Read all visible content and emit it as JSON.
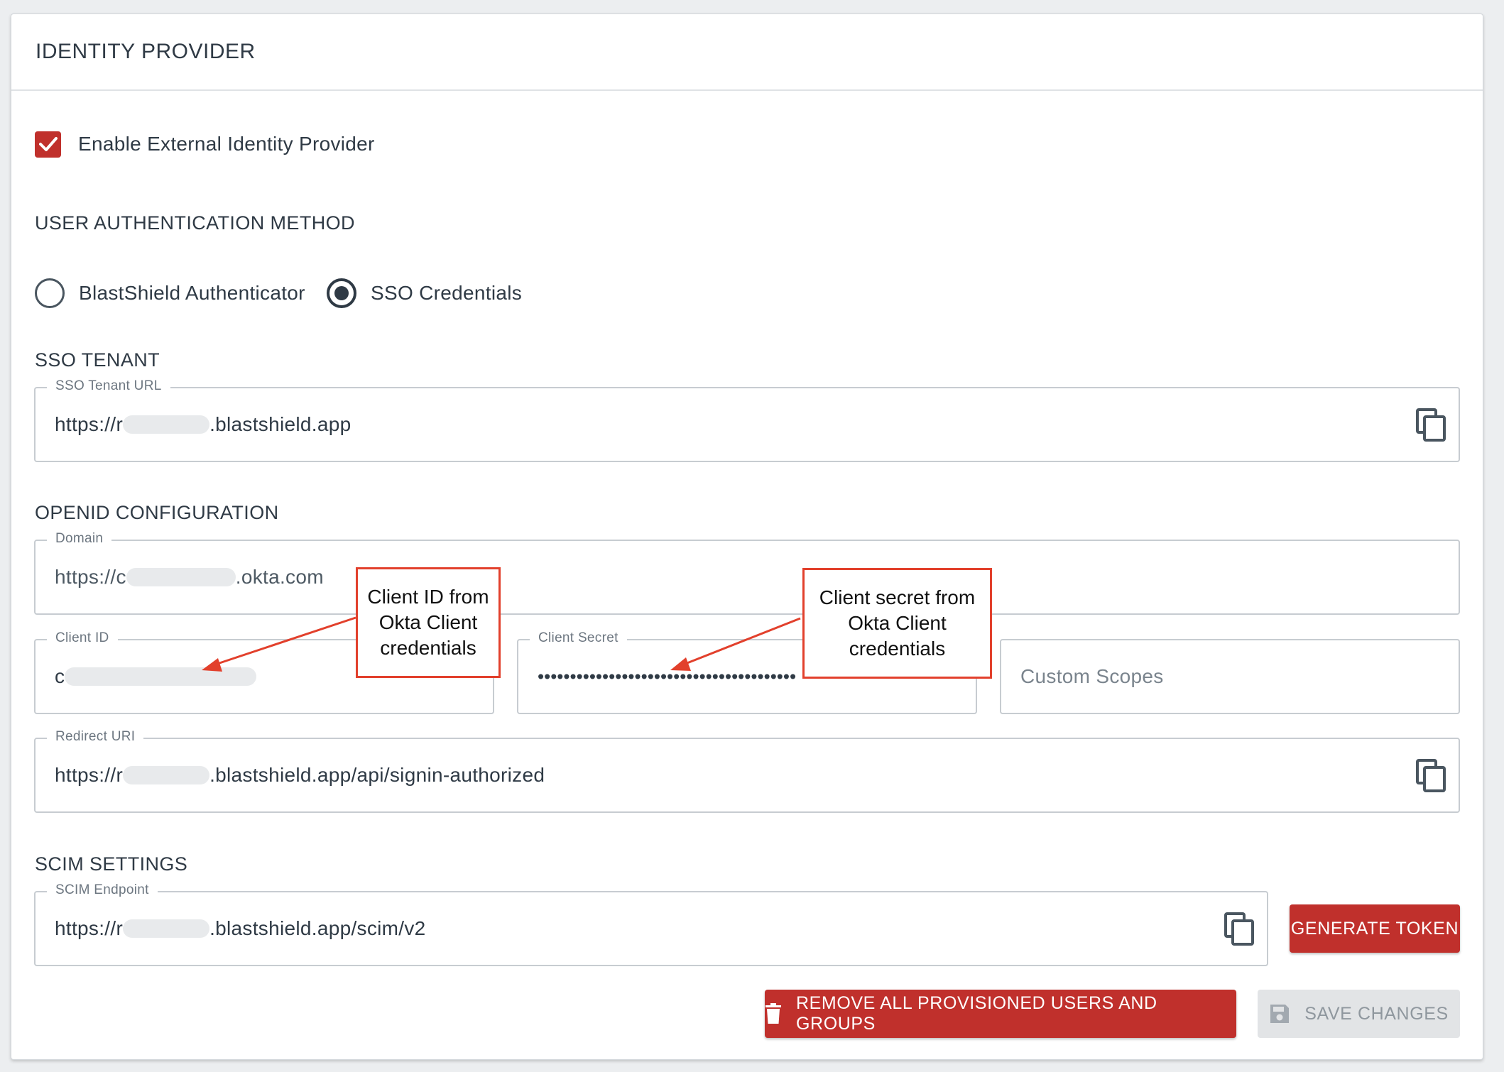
{
  "card": {
    "title": "IDENTITY PROVIDER"
  },
  "enable_idp": {
    "label": "Enable External Identity Provider",
    "checked": true
  },
  "auth_method": {
    "title": "USER AUTHENTICATION METHOD",
    "options": [
      {
        "label": "BlastShield Authenticator",
        "selected": false
      },
      {
        "label": "SSO Credentials",
        "selected": true
      }
    ]
  },
  "sso_tenant": {
    "title": "SSO TENANT",
    "url_label": "SSO Tenant URL",
    "url_prefix": "https://r",
    "url_suffix": ".blastshield.app"
  },
  "openid": {
    "title": "OPENID CONFIGURATION",
    "domain_label": "Domain",
    "domain_prefix": "https://c",
    "domain_suffix": ".okta.com",
    "client_id_label": "Client ID",
    "client_id_prefix": "c",
    "client_secret_label": "Client Secret",
    "client_secret_value": "••••••••••••••••••••••••••••••••••••••••",
    "custom_scopes_placeholder": "Custom Scopes",
    "redirect_label": "Redirect URI",
    "redirect_prefix": "https://r",
    "redirect_suffix": ".blastshield.app/api/signin-authorized"
  },
  "scim": {
    "title": "SCIM SETTINGS",
    "endpoint_label": "SCIM Endpoint",
    "endpoint_prefix": "https://r",
    "endpoint_suffix": ".blastshield.app/scim/v2",
    "generate_token_label": "GENERATE TOKEN"
  },
  "actions": {
    "remove_label": "REMOVE ALL PROVISIONED USERS AND GROUPS",
    "save_label": "SAVE CHANGES"
  },
  "callouts": {
    "client_id": [
      "Client ID from",
      "Okta Client",
      "credentials"
    ],
    "client_secret": [
      "Client secret from",
      "Okta Client",
      "credentials"
    ]
  },
  "colors": {
    "accent": "#c0302c",
    "callout": "#e2402c",
    "text": "#2f3a45",
    "border": "#c7ccd1"
  },
  "icons": [
    "check-icon",
    "copy-icon",
    "trash-icon",
    "save-icon"
  ]
}
